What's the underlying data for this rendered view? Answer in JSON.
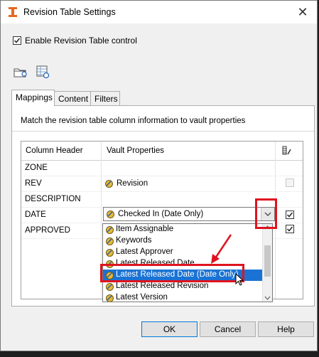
{
  "window": {
    "title": "Revision Table Settings",
    "close_glyph": "✕"
  },
  "enable_control": {
    "label": "Enable Revision Table control",
    "checked": true
  },
  "toolbar": {
    "icons": [
      "open-folder-icon",
      "table-settings-icon"
    ]
  },
  "tabs": [
    {
      "label": "Mappings",
      "active": true
    },
    {
      "label": "Content",
      "active": false
    },
    {
      "label": "Filters",
      "active": false
    }
  ],
  "mappings": {
    "instruction": "Match the revision table column information to vault properties",
    "columns": {
      "column_header": "Column Header",
      "vault_properties": "Vault Properties",
      "edit_icon": "column-edit-icon"
    },
    "rows": [
      {
        "header": "ZONE",
        "property": ""
      },
      {
        "header": "REV",
        "property": "Revision",
        "checked": false
      },
      {
        "header": "DESCRIPTION",
        "property": ""
      },
      {
        "header": "DATE",
        "property": "Checked In (Date Only)",
        "checked": true
      },
      {
        "header": "APPROVED",
        "property": "",
        "checked": true
      }
    ],
    "combo_value": "Checked In (Date Only)",
    "dropdown_options": [
      "Item Assignable",
      "Keywords",
      "Latest Approver",
      "Latest Released Date",
      "Latest Released Date (Date Only)",
      "Latest Released Revision",
      "Latest Version"
    ],
    "selected_option": "Latest Released Date (Date Only)"
  },
  "buttons": {
    "ok": "OK",
    "cancel": "Cancel",
    "help": "Help"
  },
  "colors": {
    "highlight_red": "#e0131e",
    "selection_blue": "#1a73d4",
    "accent_blue": "#0078d7"
  }
}
